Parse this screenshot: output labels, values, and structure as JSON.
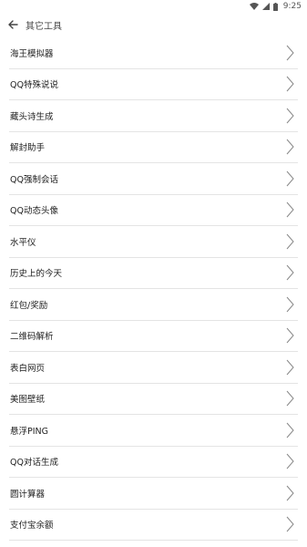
{
  "status_bar": {
    "time": "9:25",
    "icons": [
      "wifi-icon",
      "signal-icon",
      "battery-icon"
    ]
  },
  "header": {
    "back_icon": "arrow-left-icon",
    "title": "其它工具"
  },
  "list": {
    "items": [
      {
        "label": "海王模拟器"
      },
      {
        "label": "QQ特殊说说"
      },
      {
        "label": "藏头诗生成"
      },
      {
        "label": "解封助手"
      },
      {
        "label": "QQ强制会话"
      },
      {
        "label": "QQ动态头像"
      },
      {
        "label": "水平仪"
      },
      {
        "label": "历史上的今天"
      },
      {
        "label": "红包/奖励"
      },
      {
        "label": "二维码解析"
      },
      {
        "label": "表白网页"
      },
      {
        "label": "美图壁纸"
      },
      {
        "label": "悬浮PING"
      },
      {
        "label": "QQ对话生成"
      },
      {
        "label": "圆计算器"
      },
      {
        "label": "支付宝余额"
      }
    ],
    "chevron_icon": "chevron-right-icon"
  },
  "colors": {
    "divider": "#e4e4e4",
    "text": "#222222",
    "chevron": "#888888"
  }
}
